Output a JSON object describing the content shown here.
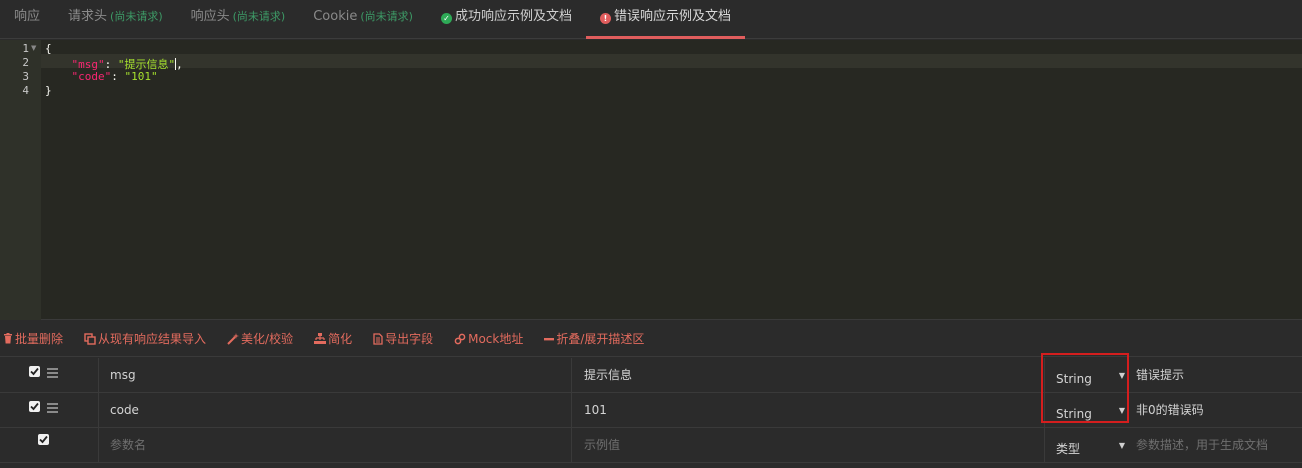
{
  "tabs": [
    {
      "label": "响应",
      "note": ""
    },
    {
      "label": "请求头",
      "note": "(尚未请求)"
    },
    {
      "label": "响应头",
      "note": "(尚未请求)"
    },
    {
      "label": "Cookie",
      "note": "(尚未请求)"
    },
    {
      "label": "成功响应示例及文档",
      "note": ""
    },
    {
      "label": "错误响应示例及文档",
      "note": ""
    }
  ],
  "editor": {
    "line_numbers": [
      "1",
      "2",
      "3",
      "4"
    ],
    "open_brace": "{",
    "close_brace": "}",
    "lines": [
      {
        "key": "\"msg\"",
        "value": "\"提示信息\""
      },
      {
        "key": "\"code\"",
        "value": "\"101\""
      }
    ]
  },
  "toolbar": {
    "batch_delete": "批量删除",
    "import_from_response": "从现有响应结果导入",
    "beautify": "美化/校验",
    "simplify": "简化",
    "export_fields": "导出字段",
    "mock_url": "Mock地址",
    "fold_toggle": "折叠/展开描述区"
  },
  "rows": [
    {
      "name": "msg",
      "example": "提示信息",
      "type": "String",
      "desc": "错误提示"
    },
    {
      "name": "code",
      "example": "101",
      "type": "String",
      "desc": "非0的错误码"
    }
  ],
  "new_row": {
    "name_placeholder": "参数名",
    "example_placeholder": "示例值",
    "type_placeholder": "类型",
    "desc_placeholder": "参数描述，用于生成文档"
  },
  "colors": {
    "accent": "#e36b5e",
    "active_tab_underline": "#e05d5d",
    "success": "#2eaa57",
    "highlight_box": "#d41e1e"
  }
}
